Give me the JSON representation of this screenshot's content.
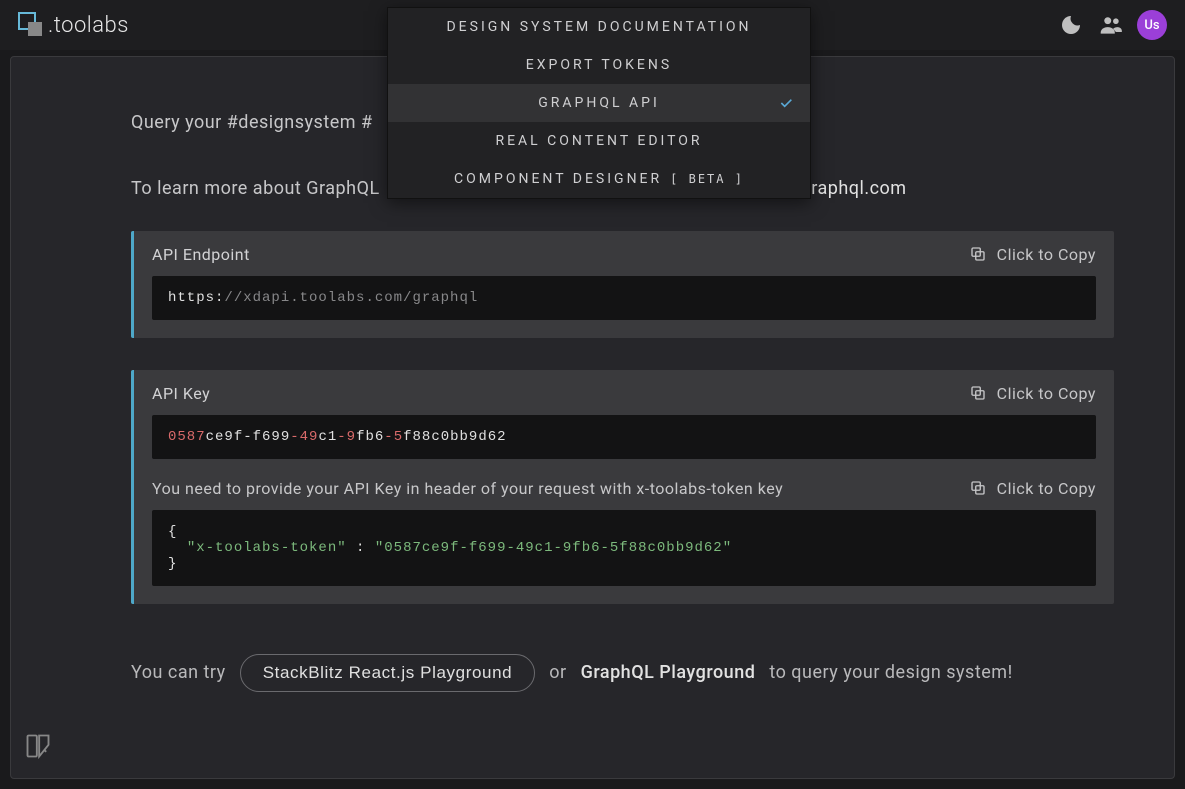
{
  "brand": {
    "name": ".toolabs",
    "avatar_label": "Us"
  },
  "dropdown": {
    "items": [
      {
        "label": "DESIGN SYSTEM DOCUMENTATION",
        "selected": false
      },
      {
        "label": "EXPORT TOKENS",
        "selected": false
      },
      {
        "label": "GRAPHQL API",
        "selected": true
      },
      {
        "label": "REAL CONTENT EDITOR",
        "selected": false
      },
      {
        "label": "COMPONENT DESIGNER",
        "beta": "[ BETA ]",
        "selected": false
      }
    ]
  },
  "intro": {
    "query_text": "Query your #designsystem #",
    "learn_prefix": "To learn more about GraphQL",
    "learn_link": "wtographql.com"
  },
  "endpoint": {
    "title": "API Endpoint",
    "copy_label": "Click to Copy",
    "scheme": "https:",
    "path": "//xdapi.toolabs.com/graphql"
  },
  "apikey": {
    "title": "API Key",
    "copy_label": "Click to Copy",
    "segments": {
      "s1": "0587",
      "s2": "ce9f-f699",
      "s3": "-49",
      "s4": "c1",
      "s5": "-9",
      "s6": "fb6",
      "s7": "-5",
      "s8": "f88c0bb9d62"
    },
    "header_note": "You need to provide your API Key in header of your request with x-toolabs-token key",
    "copy_label2": "Click to Copy",
    "json_brace_open": "{",
    "json_token_name": "\"x-toolabs-token\"",
    "json_colon": " : ",
    "json_token_value": "\"0587ce9f-f699-49c1-9fb6-5f88c0bb9d62\"",
    "json_brace_close": "}"
  },
  "footer": {
    "prefix": "You can try",
    "stackblitz_label": "StackBlitz React.js Playground",
    "or": "or",
    "playground_label": "GraphQL Playground",
    "suffix": "to query your design system!"
  }
}
